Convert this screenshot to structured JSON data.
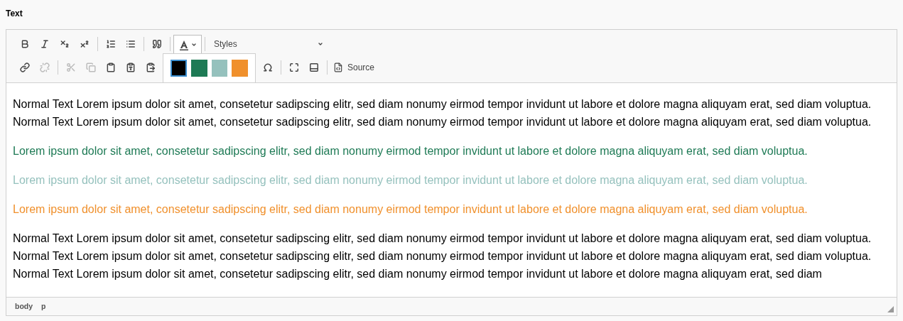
{
  "field_label": "Text",
  "toolbar": {
    "styles_dropdown": {
      "value": "Styles"
    },
    "text_color_button": {
      "pressed": true
    },
    "source_button": {
      "label": "Source"
    }
  },
  "color_palette": {
    "swatches": [
      {
        "color": "#000000",
        "selected": true
      },
      {
        "color": "#1e7a55",
        "selected": false
      },
      {
        "color": "#95c1bd",
        "selected": false
      },
      {
        "color": "#f0902c",
        "selected": false
      }
    ]
  },
  "paragraphs": [
    {
      "color": "#000000",
      "text": "Normal Text Lorem ipsum dolor sit amet, consetetur sadipscing elitr, sed diam nonumy eirmod tempor invidunt ut labore et dolore magna aliquyam erat, sed diam voluptua. Normal Text Lorem ipsum dolor sit amet, consetetur sadipscing elitr, sed diam nonumy eirmod tempor invidunt ut labore et dolore magna aliquyam erat, sed diam voluptua."
    },
    {
      "color": "#1e7a55",
      "text": "Lorem ipsum dolor sit amet, consetetur sadipscing elitr, sed diam nonumy eirmod tempor invidunt ut labore et dolore magna aliquyam erat, sed diam voluptua."
    },
    {
      "color": "#95c1bd",
      "text": "Lorem ipsum dolor sit amet, consetetur sadipscing elitr, sed diam nonumy eirmod tempor invidunt ut labore et dolore magna aliquyam erat, sed diam voluptua."
    },
    {
      "color": "#f0902c",
      "text": "Lorem ipsum dolor sit amet, consetetur sadipscing elitr, sed diam nonumy eirmod tempor invidunt ut labore et dolore magna aliquyam erat, sed diam voluptua."
    },
    {
      "color": "#000000",
      "text": "Normal Text Lorem ipsum dolor sit amet, consetetur sadipscing elitr, sed diam nonumy eirmod tempor invidunt ut labore et dolore magna aliquyam erat, sed diam voluptua. Normal Text Lorem ipsum dolor sit amet, consetetur sadipscing elitr, sed diam nonumy eirmod tempor invidunt ut labore et dolore magna aliquyam erat, sed diam voluptua. Normal Text Lorem ipsum dolor sit amet, consetetur sadipscing elitr, sed diam nonumy eirmod tempor invidunt ut labore et dolore magna aliquyam erat, sed diam"
    }
  ],
  "element_path": [
    "body",
    "p"
  ]
}
